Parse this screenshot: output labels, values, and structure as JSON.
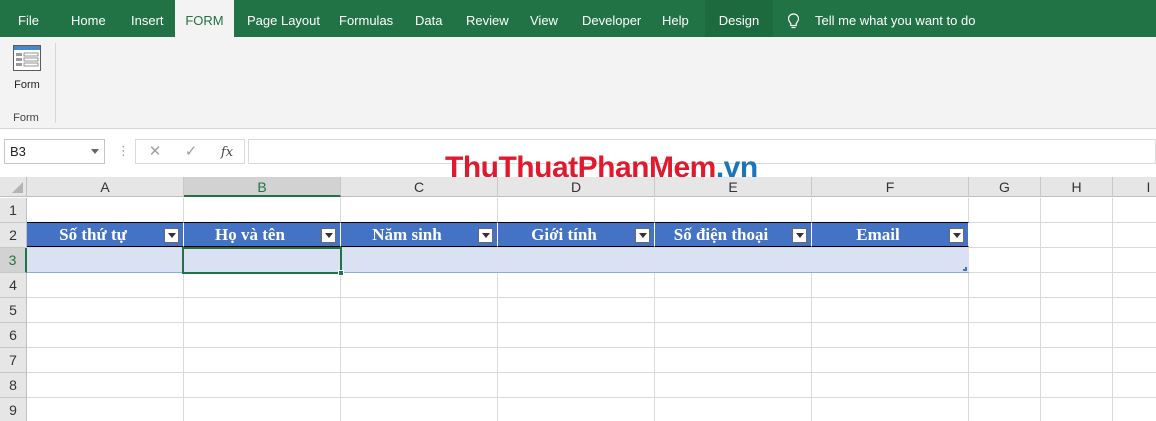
{
  "ribbon_tabs": [
    "File",
    "Home",
    "Insert",
    "FORM",
    "Page Layout",
    "Formulas",
    "Data",
    "Review",
    "View",
    "Developer",
    "Help",
    "Design"
  ],
  "active_tab": "FORM",
  "tell_me": "Tell me what you want to do",
  "ribbon": {
    "form_button_label": "Form",
    "group_label": "Form"
  },
  "formula_bar": {
    "name_box": "B3",
    "cancel_icon": "✕",
    "enter_icon": "✓",
    "fx_label": "fx",
    "formula": ""
  },
  "logo": {
    "part1": "ThuThuat",
    "part2": "PhanMem",
    "part3": ".vn"
  },
  "columns": [
    "A",
    "B",
    "C",
    "D",
    "E",
    "F",
    "G",
    "H",
    "I"
  ],
  "rows": [
    "1",
    "2",
    "3",
    "4",
    "5",
    "6",
    "7",
    "8",
    "9"
  ],
  "selected_cell": "B3",
  "table_headers": [
    "Số thứ tự",
    "Họ và tên",
    "Năm sinh",
    "Giới tính",
    "Số điện thoại",
    "Email"
  ],
  "colors": {
    "excel_green": "#217346",
    "table_header": "#4472c4",
    "table_band": "#d9e1f2"
  }
}
